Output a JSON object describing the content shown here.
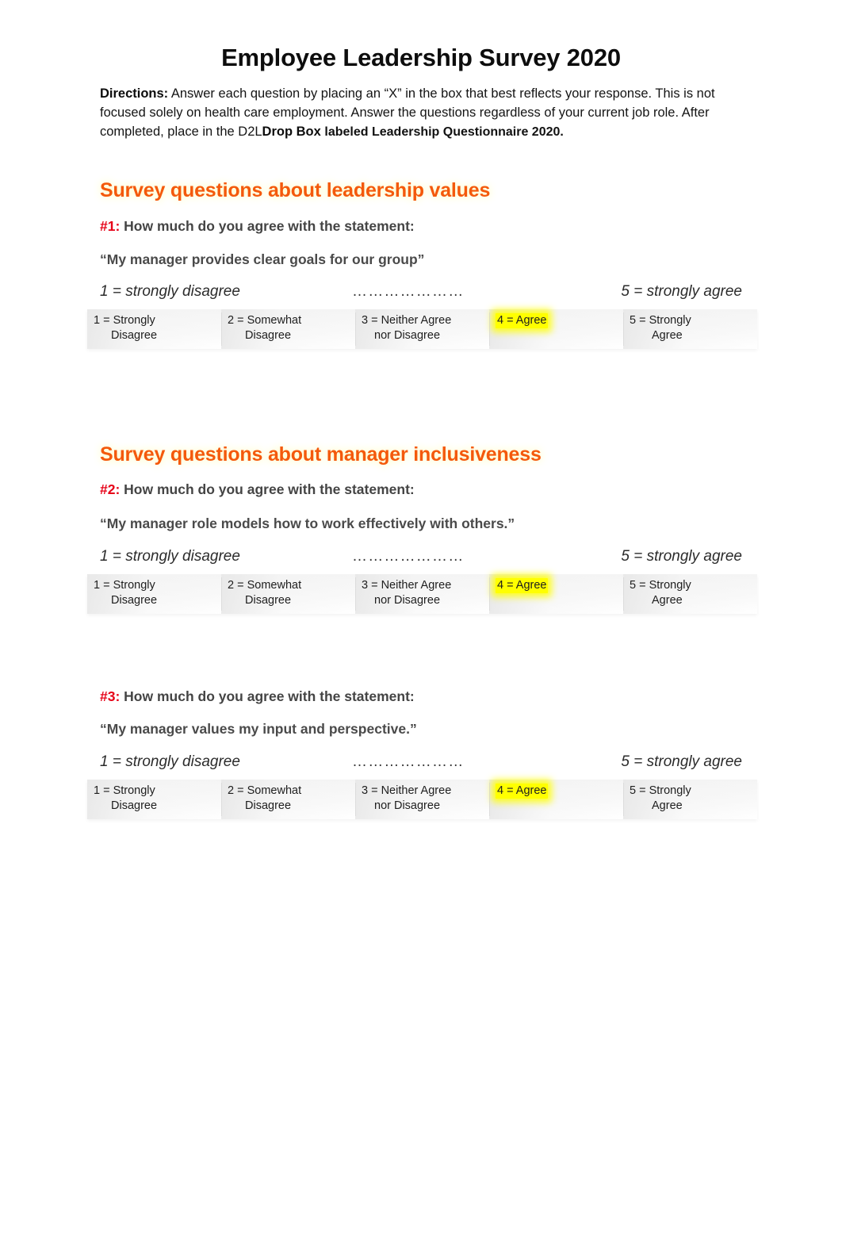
{
  "document": {
    "title": "Employee Leadership Survey 2020",
    "directions": {
      "label": "Directions:",
      "text_part1": " Answer each question by placing an “X” in the box that best reflects your response. This is not focused solely on health care employment. Answer the questions regardless of your current job role. After completed, place in the D2L",
      "bold_part": "Drop Box",
      "text_part2": "labeled Leadership Questionnaire 2020."
    }
  },
  "scale": {
    "anchor_low": "1 = strongly disagree",
    "dots": "…………………",
    "anchor_high": "5 = strongly agree",
    "options": [
      {
        "line1": "1 = Strongly",
        "line2": "Disagree"
      },
      {
        "line1": "2 = Somewhat",
        "line2": "Disagree"
      },
      {
        "line1": "3 = Neither Agree",
        "line2": "nor Disagree"
      },
      {
        "line1": "4 = Agree",
        "line2": ""
      },
      {
        "line1": "5 = Strongly",
        "line2": "Agree"
      }
    ],
    "selected_index": 3,
    "selected_label": "4 = Agree"
  },
  "sections": [
    {
      "heading": "Survey questions about leadership values",
      "questions": [
        {
          "number": "#1:",
          "prompt": "How much do you agree with the statement:",
          "statement": "“My manager provides clear goals for our group”",
          "answer": "4 = Agree"
        }
      ]
    },
    {
      "heading": "Survey questions about manager inclusiveness",
      "questions": [
        {
          "number": "#2:",
          "prompt": "How much do you agree with the statement:",
          "statement": "“My manager role models how to work effectively with others.”",
          "answer": "4 = Agree"
        },
        {
          "number": "#3:",
          "prompt": "How much do you agree with the statement:",
          "statement": "“My manager values my input and perspective.”",
          "answer": "4 = Agree"
        }
      ]
    }
  ],
  "colors": {
    "heading_orange": "#F4590C",
    "question_red": "#E60017",
    "highlight_yellow": "#FFFF00",
    "body_gray": "#444444"
  }
}
